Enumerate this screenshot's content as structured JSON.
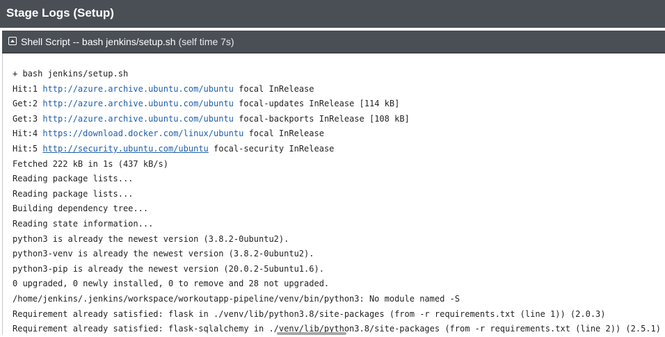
{
  "header": {
    "title": "Stage Logs (Setup)"
  },
  "step": {
    "name": "Shell Script",
    "separator": " -- ",
    "command": "bash jenkins/setup.sh",
    "meta": " (self time 7s)"
  },
  "log_lines": [
    {
      "pre": "+ bash jenkins/setup.sh"
    },
    {
      "pre": "Hit:1 ",
      "link": "http://azure.archive.ubuntu.com/ubuntu",
      "post": " focal InRelease"
    },
    {
      "pre": "Get:2 ",
      "link": "http://azure.archive.ubuntu.com/ubuntu",
      "post": " focal-updates InRelease [114 kB]"
    },
    {
      "pre": "Get:3 ",
      "link": "http://azure.archive.ubuntu.com/ubuntu",
      "post": " focal-backports InRelease [108 kB]"
    },
    {
      "pre": "Hit:4 ",
      "link": "https://download.docker.com/linux/ubuntu",
      "post": " focal InRelease"
    },
    {
      "pre": "Hit:5 ",
      "link": "http://security.ubuntu.com/ubuntu",
      "post": " focal-security InRelease",
      "underlined": true
    },
    {
      "pre": "Fetched 222 kB in 1s (437 kB/s)"
    },
    {
      "pre": "Reading package lists..."
    },
    {
      "pre": "Reading package lists..."
    },
    {
      "pre": "Building dependency tree..."
    },
    {
      "pre": "Reading state information..."
    },
    {
      "pre": "python3 is already the newest version (3.8.2-0ubuntu2)."
    },
    {
      "pre": "python3-venv is already the newest version (3.8.2-0ubuntu2)."
    },
    {
      "pre": "python3-pip is already the newest version (20.0.2-5ubuntu1.6)."
    },
    {
      "pre": "0 upgraded, 0 newly installed, 0 to remove and 28 not upgraded."
    },
    {
      "pre": "/home/jenkins/.jenkins/workspace/workoutapp-pipeline/venv/bin/python3: No module named -S"
    },
    {
      "pre": "Requirement already satisfied: flask in ./venv/lib/python3.8/site-packages (from -r requirements.txt (line 1)) (2.0.3)"
    },
    {
      "pre": "Requirement already satisfied: flask-sqlalchemy in ./venv/lib/python3.8/site-packages (from -r requirements.txt (line 2)) (2.5.1)"
    }
  ]
}
